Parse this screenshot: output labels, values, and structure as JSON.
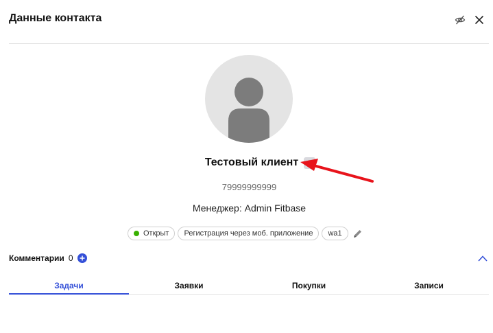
{
  "header": {
    "title": "Данные контакта",
    "hide_icon": "eye-off-icon",
    "close_icon": "close-icon"
  },
  "contact": {
    "avatar_icon": "person-silhouette-icon",
    "name": "Тестовый клиент",
    "open_icon": "arrow-up-right-icon",
    "phone": "79999999999",
    "manager": "Менеджер: Admin Fitbase"
  },
  "tags": [
    {
      "label": "Открыт",
      "status_color": "#38b000"
    },
    {
      "label": "Регистрация через моб. приложение"
    },
    {
      "label": "wa1"
    }
  ],
  "tags_edit_icon": "pencil-icon",
  "comments": {
    "label": "Комментарии",
    "count": "0",
    "add_icon": "plus-icon",
    "collapse_icon": "chevron-up-icon"
  },
  "tabs": [
    {
      "label": "Задачи",
      "active": true
    },
    {
      "label": "Заявки",
      "active": false
    },
    {
      "label": "Покупки",
      "active": false
    },
    {
      "label": "Записи",
      "active": false
    }
  ],
  "colors": {
    "accent": "#3450d8",
    "annotation_arrow": "#e8131b"
  }
}
